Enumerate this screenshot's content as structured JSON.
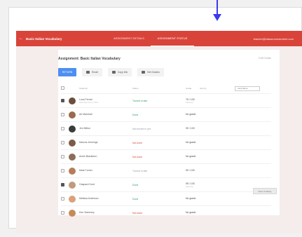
{
  "app": {
    "title": "Basic Italian Vocabulary",
    "tabs": [
      "ASSIGNMENT DETAILS",
      "ASSIGNMENT STATUS"
    ],
    "active_tab": 1,
    "user": "teacher@classroomstudent.com"
  },
  "assignment": {
    "title": "Assignment: Basic Italian Vocabulary",
    "link": "Edit Details"
  },
  "toolbar": {
    "return_label": "RETURN",
    "email_label": "Email",
    "copy_label": "Copy link",
    "grade_label": "Set Grades"
  },
  "table": {
    "columns": [
      "Students",
      "Status",
      "Grade"
    ],
    "sort_label": "Sort by",
    "sort_value": "Last Name",
    "rows": [
      {
        "name": "Luca Ferrari",
        "sub": "Submitted: Nov 5, 2014",
        "status": "Turned in late",
        "status_color": "#2e9e5b",
        "grade": "75 / 100",
        "grade_sub": "Returned",
        "checked": true,
        "avatar": "#6b4e3d"
      },
      {
        "name": "Ari Marshall",
        "sub": "",
        "status": "Done",
        "status_color": "#2e9e5b",
        "grade": "No grade",
        "grade_sub": "",
        "checked": false,
        "avatar": "#9b6a4f"
      },
      {
        "name": "Jen Milton",
        "sub": "",
        "status": "Not turned in yet",
        "status_color": "#999999",
        "grade": "90 / 100",
        "grade_sub": "",
        "checked": false,
        "avatar": "#3b3b3b"
      },
      {
        "name": "Marcus Jennings",
        "sub": "",
        "status": "Not done",
        "status_color": "#d9443a",
        "grade": "No grade",
        "grade_sub": "",
        "checked": false,
        "avatar": "#7d5a48"
      },
      {
        "name": "Annie Blackburn",
        "sub": "",
        "status": "Not done",
        "status_color": "#d9443a",
        "grade": "No grade",
        "grade_sub": "",
        "checked": false,
        "avatar": "#8a6d5a"
      },
      {
        "name": "Mark Turner",
        "sub": "",
        "status": "Turned in late",
        "status_color": "#999999",
        "grade": "90 / 100",
        "grade_sub": "",
        "checked": false,
        "avatar": "#b87c5a"
      },
      {
        "name": "Gaspard Hunt",
        "sub": "",
        "status": "Done",
        "status_color": "#2e9e5b",
        "grade": "95 / 100",
        "grade_sub": "Returned",
        "checked": true,
        "avatar": "#c29a7d"
      },
      {
        "name": "Melissa Anderson",
        "sub": "",
        "status": "Done",
        "status_color": "#2e9e5b",
        "grade": "No grade",
        "grade_sub": "",
        "checked": false,
        "avatar": "#d9a27a"
      },
      {
        "name": "Ken Sweeney",
        "sub": "",
        "status": "Not done",
        "status_color": "#d9443a",
        "grade": "No grade",
        "grade_sub": "",
        "checked": false,
        "avatar": "#c48a5a"
      }
    ]
  },
  "footer": {
    "button_label": "Done Grading"
  },
  "colors": {
    "brand": "#d9443a",
    "primary": "#4d8ff0",
    "pointer": "#3a3af0"
  },
  "icons": [
    "back-arrow-icon",
    "email-icon",
    "link-icon",
    "grade-icon",
    "pointer-arrow-icon"
  ]
}
